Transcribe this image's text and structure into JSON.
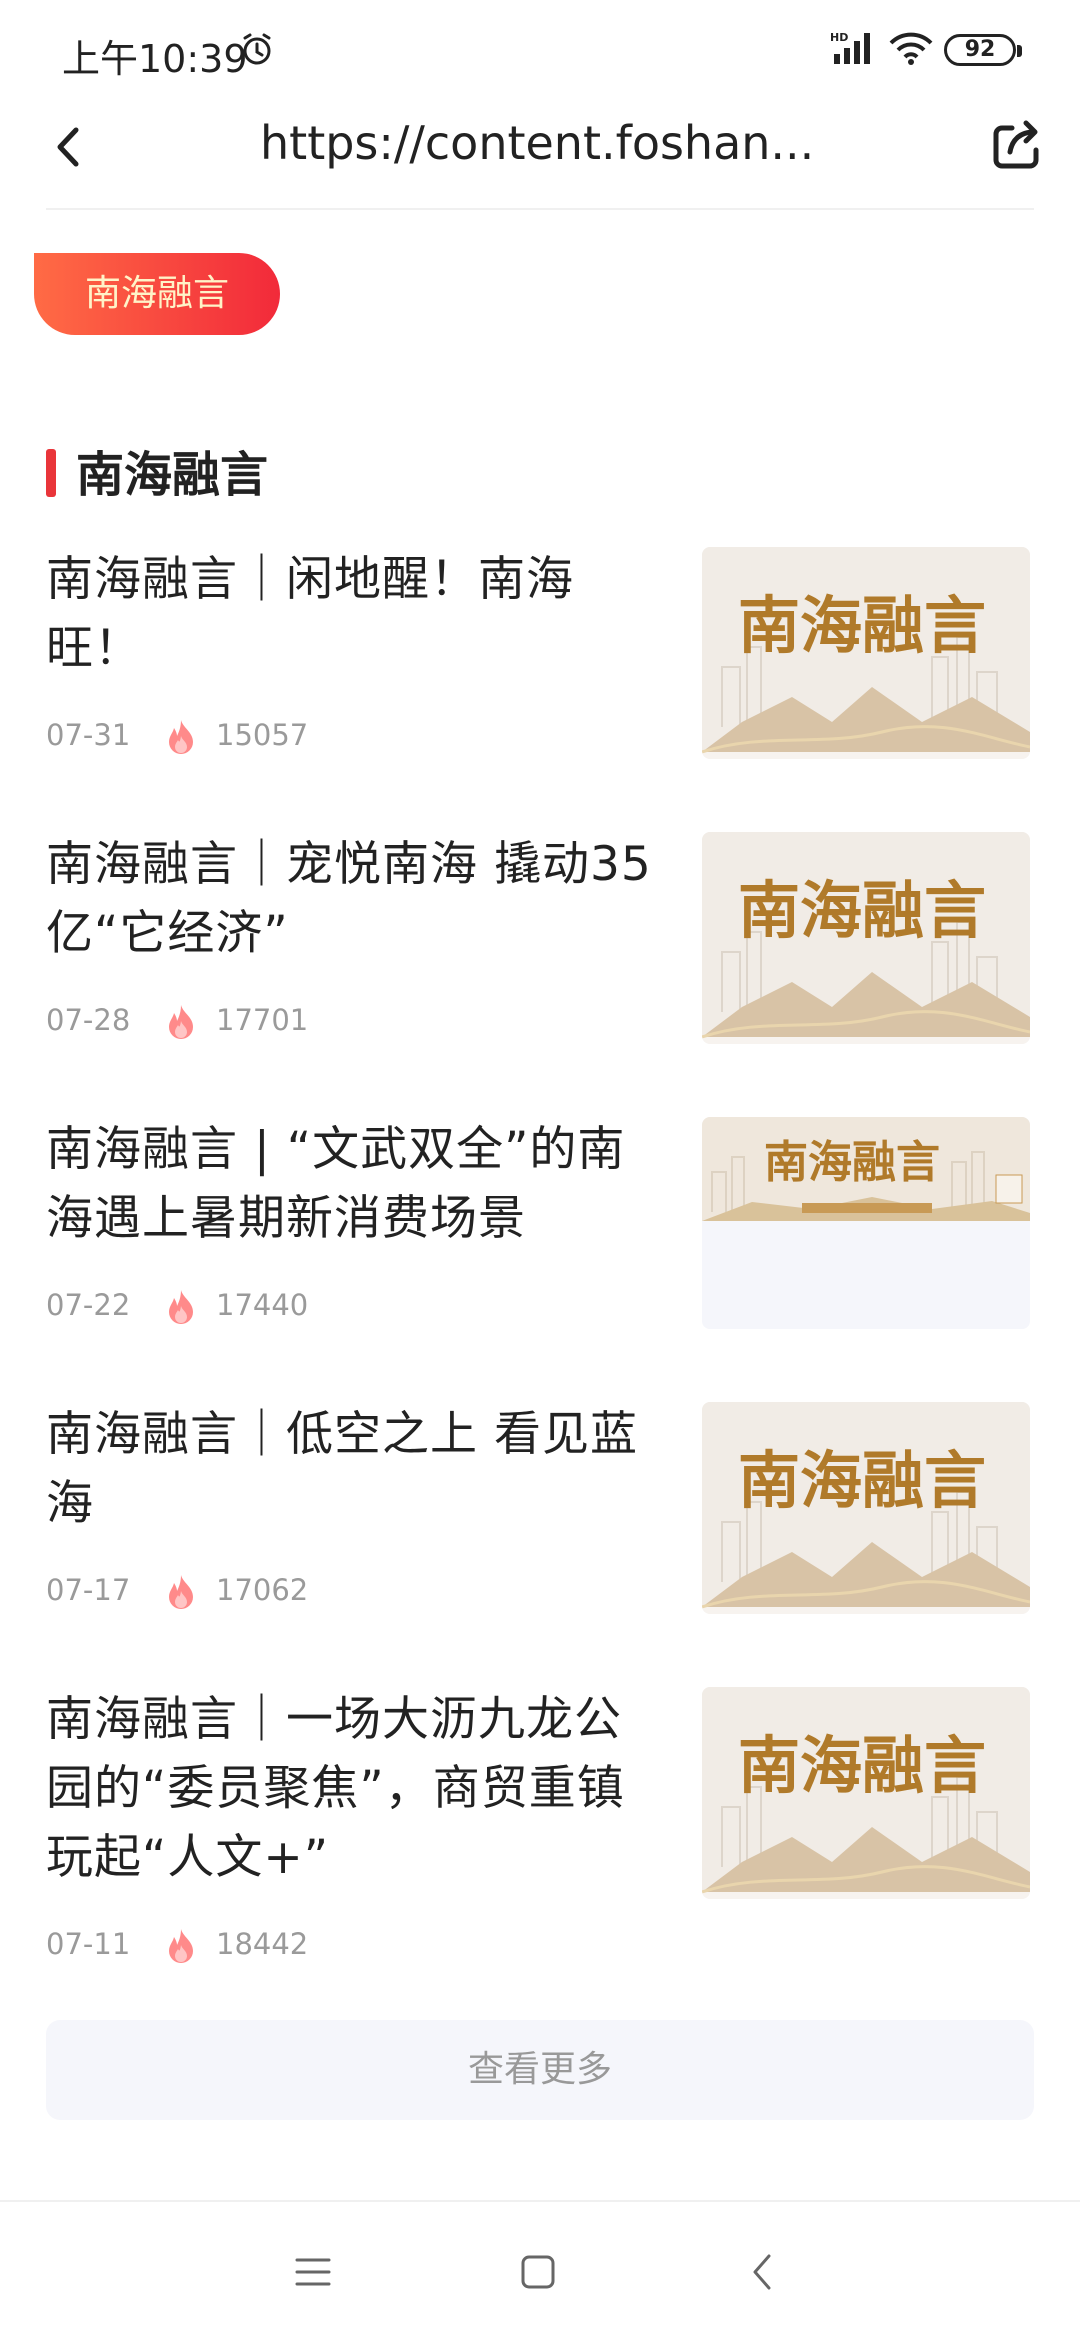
{
  "status_bar": {
    "time": "上午10:39",
    "signal_label": "HD",
    "battery": "92"
  },
  "browser": {
    "url": "https://content.foshan..."
  },
  "tag": {
    "label": "南海融言"
  },
  "section": {
    "title": "南海融言"
  },
  "articles": [
    {
      "title": "南海融言｜闲地醒！南海旺！",
      "date": "07-31",
      "views": "15057",
      "thumb_text": "南海融言"
    },
    {
      "title": "南海融言｜宠悦南海 撬动35亿“它经济”",
      "date": "07-28",
      "views": "17701",
      "thumb_text": "南海融言"
    },
    {
      "title": "南海融言 | “文武双全”的南海遇上暑期新消费场景",
      "date": "07-22",
      "views": "17440",
      "thumb_text": "南海融言"
    },
    {
      "title": "南海融言｜低空之上 看见蓝海",
      "date": "07-17",
      "views": "17062",
      "thumb_text": "南海融言"
    },
    {
      "title": "南海融言｜一场大沥九龙公园的“委员聚焦”，商贸重镇玩起“人文+”",
      "date": "07-11",
      "views": "18442",
      "thumb_text": "南海融言"
    }
  ],
  "more_button": {
    "label": "查看更多"
  },
  "colors": {
    "accent": "#e9353a",
    "pill_start": "#ff6b45",
    "pill_end": "#f22a3a",
    "thumb_gold": "#b07a2a"
  }
}
